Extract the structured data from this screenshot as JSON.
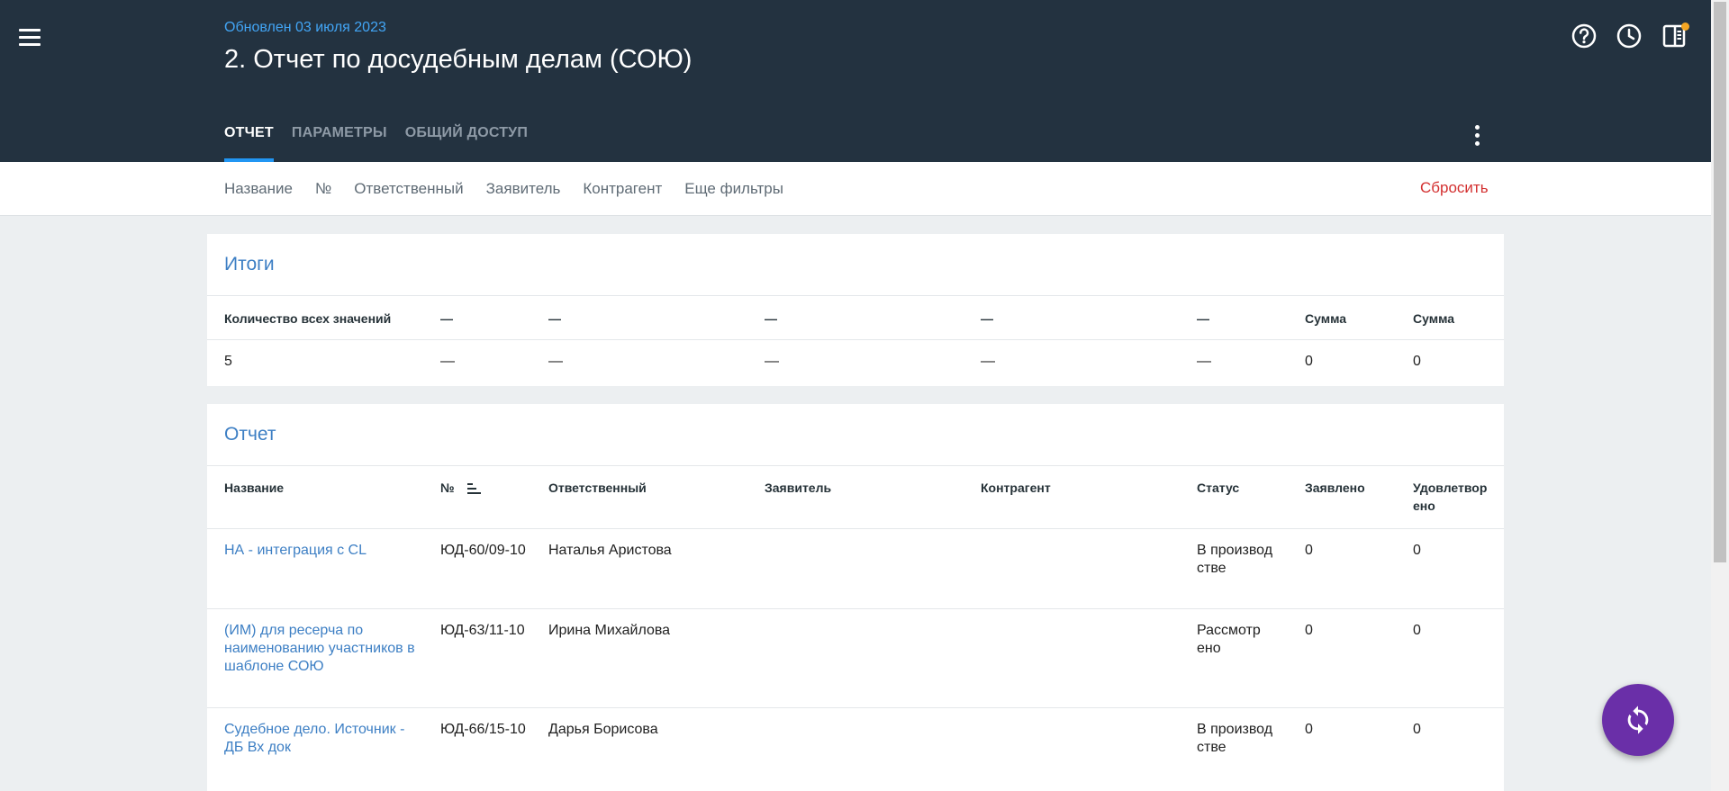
{
  "header": {
    "updated": "Обновлен 03 июля 2023",
    "title": "2. Отчет по досудебным делам (СОЮ)",
    "tabs": [
      {
        "label": "ОТЧЕТ",
        "active": true
      },
      {
        "label": "ПАРАМЕТРЫ",
        "active": false
      },
      {
        "label": "ОБЩИЙ ДОСТУП",
        "active": false
      }
    ],
    "icons": [
      "help-icon",
      "history-icon",
      "panel-icon"
    ]
  },
  "filters": {
    "items": [
      "Название",
      "№",
      "Ответственный",
      "Заявитель",
      "Контрагент",
      "Еще фильтры"
    ],
    "reset": "Сбросить"
  },
  "totals": {
    "title": "Итоги",
    "headers": [
      "Количество всех значений",
      "—",
      "—",
      "—",
      "—",
      "—",
      "Сумма",
      "Сумма"
    ],
    "values": [
      "5",
      "—",
      "—",
      "—",
      "—",
      "—",
      "0",
      "0"
    ]
  },
  "report": {
    "title": "Отчет",
    "headers": [
      "Название",
      "№",
      "Ответственный",
      "Заявитель",
      "Контрагент",
      "Статус",
      "Заявлено",
      "Удовлетвор ено"
    ],
    "rows": [
      [
        "НА - интеграция с CL",
        "ЮД-60/09-10",
        "Наталья Аристова",
        "",
        "",
        "В производ стве",
        "0",
        "0"
      ],
      [
        "(ИМ) для ресерча по наименованию участников в шаблоне СОЮ",
        "ЮД-63/11-10",
        "Ирина Михайлова",
        "",
        "",
        "Рассмотр ено",
        "0",
        "0"
      ],
      [
        "Судебное дело. Источник - ДБ Вх док",
        "ЮД-66/15-10",
        "Дарья Борисова",
        "",
        "",
        "В производ стве",
        "0",
        "0"
      ]
    ]
  },
  "colors": {
    "header_bg": "#233240",
    "accent_blue": "#2196f3",
    "link_blue": "#3d7fc4",
    "reset_red": "#d32f2f",
    "fab_purple": "#6a2fa8",
    "notification_dot": "#f5a623"
  },
  "fab": {
    "icon": "sync-icon"
  }
}
